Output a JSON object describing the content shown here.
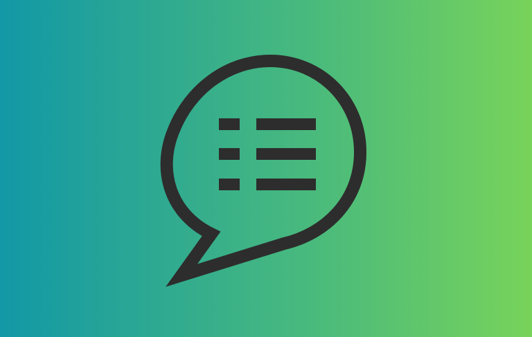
{
  "background": {
    "gradient_start": "#1298a6",
    "gradient_mid": "#4dbc7a",
    "gradient_end": "#77d35a"
  },
  "icon": {
    "name": "chat-bubble-list-icon",
    "color": "#2d2d2d"
  }
}
